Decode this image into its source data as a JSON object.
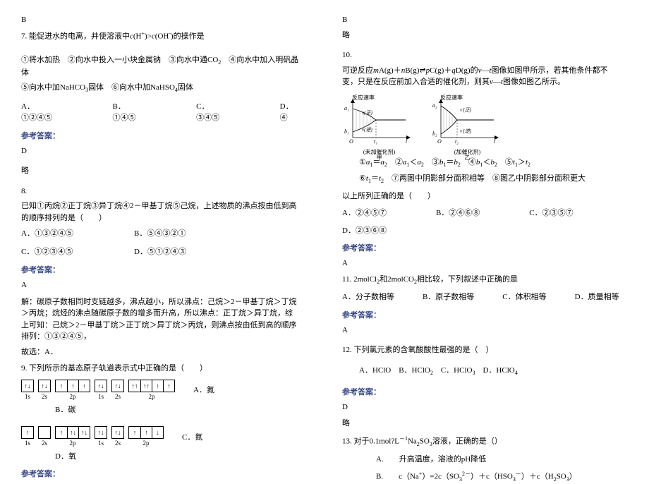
{
  "left": {
    "pre_b": "B",
    "q7": {
      "stem": "7. 能促进水的电离，并使溶液中c(H⁺)>c(OH⁻)的操作是",
      "options_line": "①将水加热　②向水中投入一小块金属钠　③向水中通CO₂　④向水中加入明矾晶体",
      "options_line2": "⑤向水中加NaHCO₃固体　⑥向水中加NaHSO₄固体",
      "choices": {
        "a": "A．①②④⑤",
        "b": "B．①④⑤",
        "c": "C．③④⑤",
        "d": "D．④"
      },
      "ans_label": "参考答案：",
      "ans": "D",
      "note": "略"
    },
    "q8": {
      "stem": "8.",
      "body1": "已知①丙烷②正丁烷③异丁烷④2－甲基丁烷⑤己烷，上述物质的沸点按由低到高的顺序排列的是（　　）",
      "choices_row1": {
        "a": "A．①③②④⑤",
        "b": "B．⑤④③②①"
      },
      "choices_row2": {
        "c": "C．①②③④⑤",
        "d": "D．⑤①②④③"
      },
      "ans_label": "参考答案：",
      "ans": "A",
      "expl1": "解：碳原子数相同时支链越多，沸点越小，所以沸点：己烷＞2－甲基丁烷＞丁烷＞丙烷；烷烃的沸点随碳原子数的增多而升高，所以沸点：正丁烷＞异丁烷，综上可知：己烷＞2－甲基丁烷＞正丁烷＞异丁烷＞丙烷，则沸点按由低到高的顺序排列：①③②④⑤，",
      "expl2": "故选：A．"
    },
    "q9": {
      "stem": "9. 下列所示的基态原子轨道表示式中正确的是（　　）",
      "labels": {
        "s1": "1s",
        "s2": "2s",
        "p2": "2p"
      },
      "optA": "A．氮",
      "optB": "B．碳",
      "optC": "C．氮",
      "optD": "D．氧",
      "ans_label": "参考答案："
    }
  },
  "right": {
    "pre_b": "B",
    "pre_note": "略",
    "q10": {
      "stem": "10.",
      "body": "可逆反应mA(g)＋nB(g)⇌pC(g)＋qD(g)的v—t图像如图甲所示，若其他条件都不变，只是在反应前加入合适的催化剂，则其v—t图像如图乙所示。",
      "diagram": {
        "ylabel": "反应速率",
        "caption1": "(未加催化剂)",
        "caption2": "(加催化剂)",
        "cap1_sub": "甲",
        "cap2_sub": "乙"
      },
      "options1": "①a₁＝a₂　②a₁＜a₂　③b₁＝b₂　④b₁＜b₂　⑤t₁＞t₂",
      "options2": "⑥t₁＝t₂　⑦两图中阴影部分面积相等　⑧图乙中阴影部分面积更大",
      "conclusion": "以上所列正确的是（　　）",
      "choices": {
        "a": "A．②④⑤⑦",
        "b": "B．②④⑥⑧",
        "c": "C．②③⑤⑦",
        "d": "D．②③⑥⑧"
      },
      "ans_label": "参考答案：",
      "ans": "A"
    },
    "q11": {
      "stem": "11. 2molCl₂和2molCO₂相比较，下列叙述中正确的是",
      "choices": {
        "a": "A．分子数相等",
        "b": "B．原子数相等",
        "c": "C．体积相等",
        "d": "D．质量相等"
      },
      "ans_label": "参考答案：",
      "ans": "A"
    },
    "q12": {
      "stem": "12. 下列氯元素的含氧酸酸性最强的是（　）",
      "choices": {
        "a": "A．HClO",
        "b": "B．HClO₂",
        "c": "C．HClO₃",
        "d": "D．HClO₄"
      },
      "ans_label": "参考答案：",
      "ans": "D",
      "note": "略"
    },
    "q13": {
      "stem": "13. 对于0.1mol?L⁻¹Na₂SO₃溶液，正确的是（）",
      "optA": "A.　　升高温度，溶液的pH降低",
      "optB": "B.　　c（Na⁺）=2c（SO₃²⁻）＋c（HSO₃⁻）＋c（H₂SO₃）"
    }
  }
}
